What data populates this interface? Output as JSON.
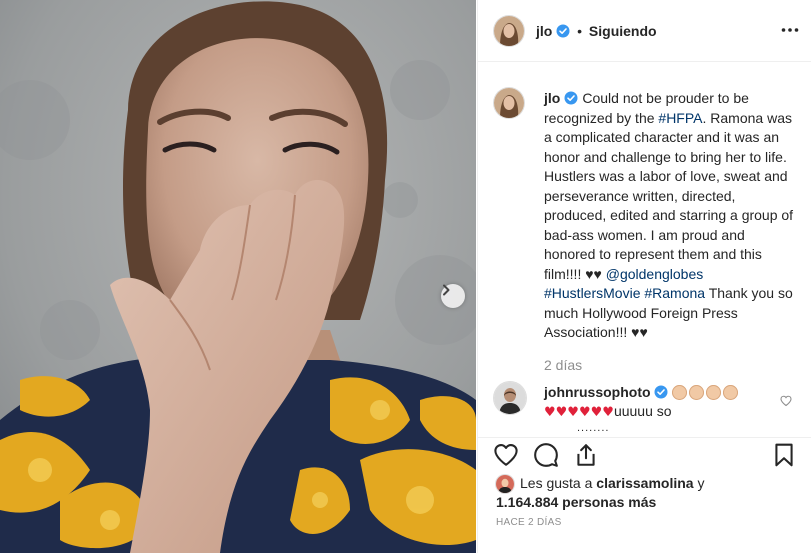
{
  "post_author": {
    "username": "jlo",
    "verified": true,
    "follow_status": "Siguiendo",
    "separator": "•"
  },
  "caption": {
    "username": "jlo",
    "text_before_tag": "Could not be prouder to be recognized by the ",
    "tag1": "#HFPA",
    "text_mid": ". Ramona was a complicated character and it was an honor and challenge to bring her to life. Hustlers was a labor of love, sweat and perseverance written, directed, produced, edited and starring a group of bad-ass women. I am proud and honored to represent them and this film!!!! ♥♥ ",
    "mention": "@goldenglobes",
    "tag2": "#HustlersMovie",
    "tag3": "#Ramona",
    "text_end": " Thank you so much Hollywood Foreign Press Association!!! ♥♥",
    "time_ago": "2 días"
  },
  "comment": {
    "username": "johnrusso­photo",
    "clap_count": 4,
    "hearts": "♥♥♥♥♥♥",
    "text_tail": "uuuuu so",
    "reply_hint": "........"
  },
  "likes": {
    "prefix": "Les gusta a ",
    "liker": "clarissamolina",
    "connector": " y",
    "count_text": "1.164.884 personas más"
  },
  "timestamp": "HACE 2 DÍAS",
  "icons": {
    "media_next": "chevron-right-icon",
    "like": "heart-outline-icon",
    "comment": "speech-bubble-icon",
    "share": "share-icon",
    "save": "bookmark-icon",
    "more": "more-horizontal-icon",
    "verified": "verified-badge-icon"
  },
  "colors": {
    "verified_blue": "#3897f0",
    "link_blue": "#003569",
    "secondary_text": "#8e8e8e",
    "heart_red": "#e0213a"
  }
}
